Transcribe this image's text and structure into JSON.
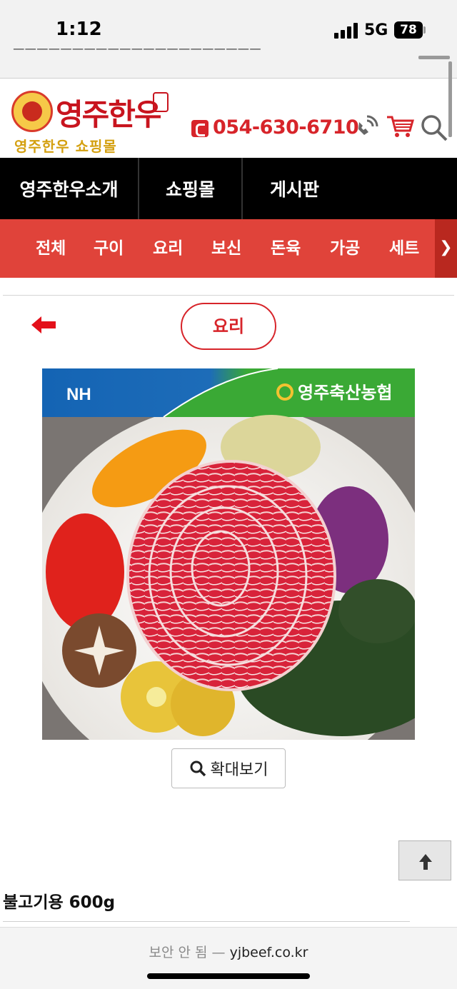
{
  "status_bar": {
    "time": "1:12",
    "network": "5G",
    "battery": "78"
  },
  "header": {
    "logo_title": "영주한우",
    "logo_subtitle": "영주한우 쇼핑몰",
    "phone": "054-630-6710"
  },
  "main_nav": {
    "items": [
      "영주한우소개",
      "쇼핑몰",
      "게시판"
    ]
  },
  "categories": {
    "items": [
      "전체",
      "구이",
      "요리",
      "보신",
      "돈육",
      "가공",
      "세트"
    ]
  },
  "page": {
    "category_label": "요리",
    "zoom_label": "확대보기"
  },
  "product_image": {
    "brand_left": "NH",
    "brand_right": "영주축산농협"
  },
  "product": {
    "name": "불고기용 600g"
  },
  "browser": {
    "insecure_label": "보안 안 됨 —",
    "domain": "yjbeef.co.kr"
  },
  "colors": {
    "accent_red": "#d7242a",
    "category_bar": "#e0433a",
    "nav_bg": "#000000",
    "nh_green": "#3aa935",
    "nh_blue": "#1464b4"
  }
}
